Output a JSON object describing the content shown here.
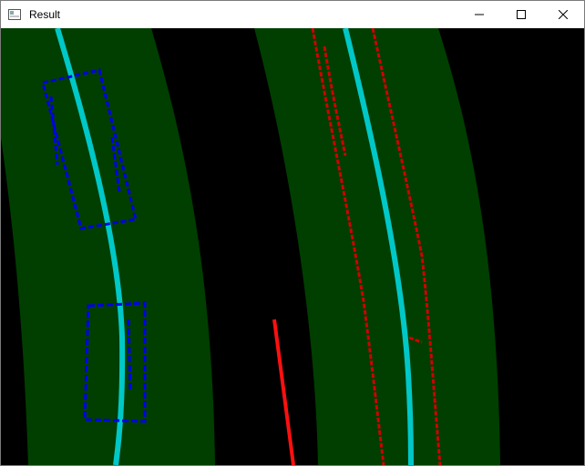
{
  "window": {
    "title": "Result",
    "icon": "opencv-window-icon"
  },
  "controls": {
    "minimize_icon": "minimize-icon",
    "maximize_icon": "maximize-icon",
    "close_icon": "close-icon"
  },
  "result_image": {
    "lane_fill_color": "#003f00",
    "left_lane_pixels_color": "#0000e6",
    "right_lane_pixels_color": "#d00000",
    "fitted_line_color": "#00c8c8",
    "stray_segment_color": "#ff1010",
    "background_color": "#000000"
  }
}
